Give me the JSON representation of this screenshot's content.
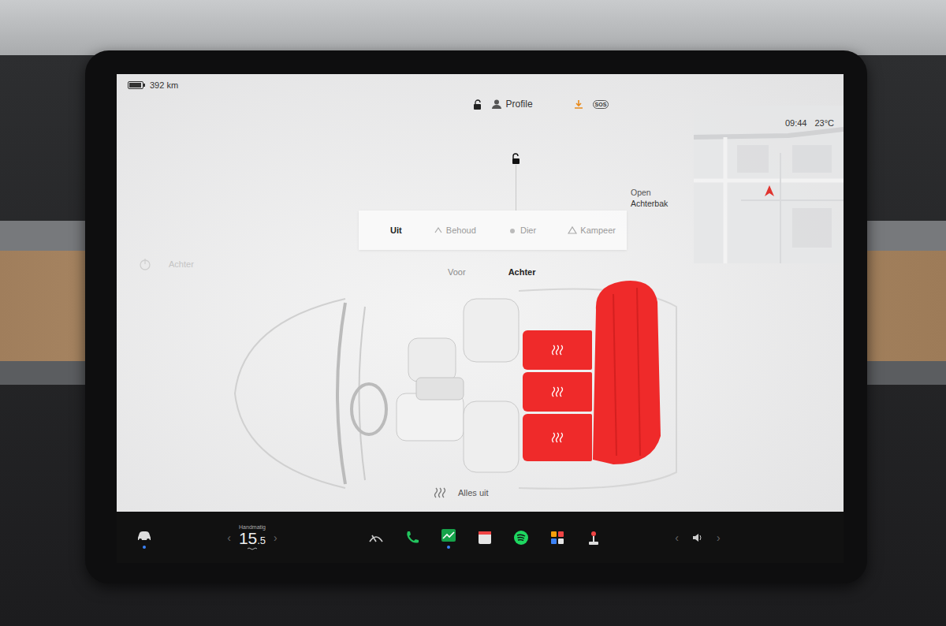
{
  "status_bar": {
    "range": "392 km",
    "profile": "Profile",
    "sos": "SOS",
    "time": "09:44",
    "outside_temp": "23°C"
  },
  "trunk": {
    "line1": "Open",
    "line2": "Achterbak"
  },
  "modes": [
    {
      "label": "Uit",
      "selected": true
    },
    {
      "label": "Behoud",
      "selected": false
    },
    {
      "label": "Dier",
      "selected": false
    },
    {
      "label": "Kampeer",
      "selected": false
    }
  ],
  "side_label": "Achter",
  "zones": [
    {
      "label": "Voor",
      "selected": false
    },
    {
      "label": "Achter",
      "selected": true
    }
  ],
  "rear_seats": [
    {
      "level": 1
    },
    {
      "level": 1
    },
    {
      "level": 1
    }
  ],
  "all_off": "Alles uit",
  "dock": {
    "climate_mode": "Handmatig",
    "temp": "15",
    "temp_decimal": ".5",
    "left_chevron": "‹",
    "right_chevron": "›"
  }
}
